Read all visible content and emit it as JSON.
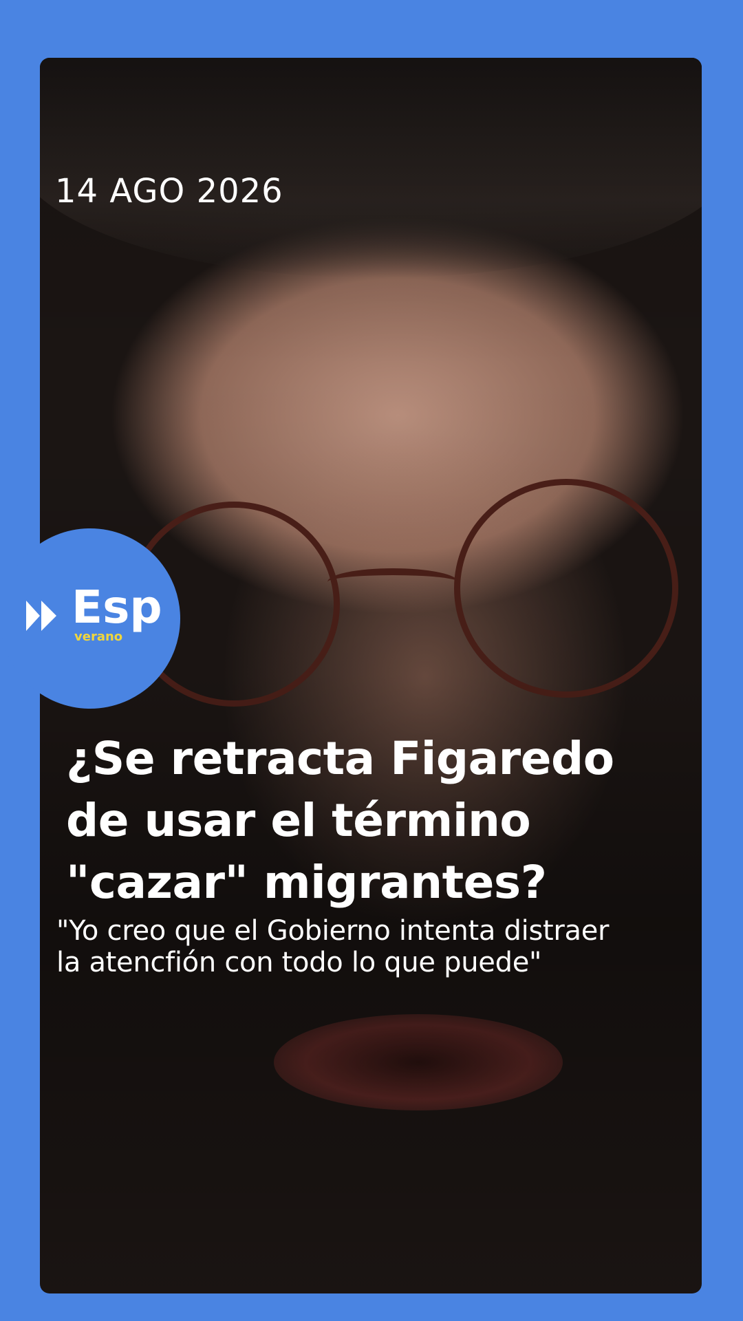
{
  "post": {
    "date": "14 AGO 2026",
    "headline_lines": [
      "¿Se retracta Figaredo",
      "de usar el término",
      "\"cazar\" migrantes?"
    ],
    "quote_lines": [
      "\"Yo creo que el Gobierno intenta distraer",
      "la atencfión con todo lo que puede\""
    ]
  },
  "logo": {
    "text": "Esp",
    "subtext": "verano",
    "icon": "play-forward-icon"
  },
  "colors": {
    "background": "#4a84e2",
    "logo_accent": "#f0d63c",
    "text": "#ffffff"
  }
}
